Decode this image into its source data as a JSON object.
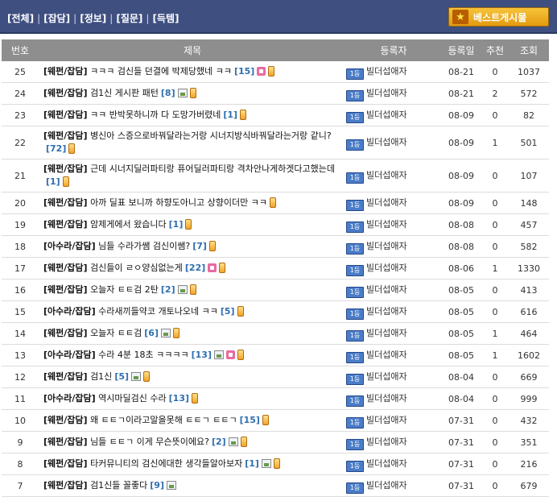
{
  "header": {
    "categories": [
      "[전체]",
      "[잡담]",
      "[정보]",
      "[질문]",
      "[득템]"
    ],
    "separator": "|",
    "best_button": "베스트게시물"
  },
  "table": {
    "columns": [
      "번호",
      "제목",
      "등록자",
      "등록일",
      "추천",
      "조회"
    ],
    "rows": [
      {
        "num": "25",
        "cat": "[웨펀/잡담]",
        "title": "ㅋㅋㅋ 검신들 던결에 박제당했네 ㅋㅋ",
        "comments": "[15]",
        "icons": [
          "movie",
          "mobile"
        ],
        "level": "1등",
        "author": "빌더섭애자",
        "date": "08-21",
        "rec": "0",
        "views": "1037"
      },
      {
        "num": "24",
        "cat": "[웨펀/잡담]",
        "title": "검1신 게시판 패턴",
        "comments": "[8]",
        "icons": [
          "image",
          "mobile"
        ],
        "level": "1등",
        "author": "빌더섭애자",
        "date": "08-21",
        "rec": "2",
        "views": "572"
      },
      {
        "num": "23",
        "cat": "[웨펀/잡담]",
        "title": "ㅋㅋ 반박못하니까 다 도망가버렸네",
        "comments": "[1]",
        "icons": [
          "mobile"
        ],
        "level": "1등",
        "author": "빌더섭애자",
        "date": "08-09",
        "rec": "0",
        "views": "82"
      },
      {
        "num": "22",
        "cat": "[웨펀/잡담]",
        "title": "병신아 스증으로바꿔달라는거랑 시너지방식바꿔달라는거랑 같니?",
        "comments": "[72]",
        "icons": [
          "mobile"
        ],
        "level": "1등",
        "author": "빌더섭애자",
        "date": "08-09",
        "rec": "1",
        "views": "501",
        "tall": true
      },
      {
        "num": "21",
        "cat": "[웨펀/잡담]",
        "title": "근데 시너지딜러파티랑 퓨어딜러파티랑 격차안나게하겟다고했는데",
        "comments": "[1]",
        "icons": [
          "mobile"
        ],
        "level": "1등",
        "author": "빌더섭애자",
        "date": "08-09",
        "rec": "0",
        "views": "107",
        "tall": true
      },
      {
        "num": "20",
        "cat": "[웨펀/잡담]",
        "title": "아까 딜표 보니까 하향도아니고 상향이더만 ㅋㅋ",
        "comments": "",
        "icons": [
          "mobile"
        ],
        "level": "1등",
        "author": "빌더섭애자",
        "date": "08-09",
        "rec": "0",
        "views": "148"
      },
      {
        "num": "19",
        "cat": "[웨펀/잡담]",
        "title": "암제게에서 왔습니다",
        "comments": "[1]",
        "icons": [
          "mobile"
        ],
        "level": "1등",
        "author": "빌더섭애자",
        "date": "08-08",
        "rec": "0",
        "views": "457"
      },
      {
        "num": "18",
        "cat": "[아수라/잡담]",
        "title": "님들 수라가쌤 검신이쌤?",
        "comments": "[7]",
        "icons": [
          "mobile"
        ],
        "level": "1등",
        "author": "빌더섭애자",
        "date": "08-08",
        "rec": "0",
        "views": "582"
      },
      {
        "num": "17",
        "cat": "[웨펀/잡담]",
        "title": "검신들이 ㄹㅇ양심없는게",
        "comments": "[22]",
        "icons": [
          "movie",
          "mobile"
        ],
        "level": "1등",
        "author": "빌더섭애자",
        "date": "08-06",
        "rec": "1",
        "views": "1330"
      },
      {
        "num": "16",
        "cat": "[웨펀/잡담]",
        "title": "오늘자 ㅌㅌ검 2탄",
        "comments": "[2]",
        "icons": [
          "image",
          "mobile"
        ],
        "level": "1등",
        "author": "빌더섭애자",
        "date": "08-05",
        "rec": "0",
        "views": "413"
      },
      {
        "num": "15",
        "cat": "[아수라/잡담]",
        "title": "수라새끼들약코 개토나오네 ㅋㅋ",
        "comments": "[5]",
        "icons": [
          "mobile"
        ],
        "level": "1등",
        "author": "빌더섭애자",
        "date": "08-05",
        "rec": "0",
        "views": "616"
      },
      {
        "num": "14",
        "cat": "[웨펀/잡담]",
        "title": "오늘자 ㅌㅌ검",
        "comments": "[6]",
        "icons": [
          "image",
          "mobile"
        ],
        "level": "1등",
        "author": "빌더섭애자",
        "date": "08-05",
        "rec": "1",
        "views": "464"
      },
      {
        "num": "13",
        "cat": "[아수라/잡담]",
        "title": "수라 4분 18초 ㅋㅋㅋㅋ",
        "comments": "[13]",
        "icons": [
          "image",
          "movie",
          "mobile"
        ],
        "level": "1등",
        "author": "빌더섭애자",
        "date": "08-05",
        "rec": "1",
        "views": "1602"
      },
      {
        "num": "12",
        "cat": "[웨펀/잡담]",
        "title": "검1신",
        "comments": "[5]",
        "icons": [
          "image",
          "mobile"
        ],
        "level": "1등",
        "author": "빌더섭애자",
        "date": "08-04",
        "rec": "0",
        "views": "669"
      },
      {
        "num": "11",
        "cat": "[아수라/잡담]",
        "title": "역시마딜검신 수라",
        "comments": "[13]",
        "icons": [
          "mobile"
        ],
        "level": "1등",
        "author": "빌더섭애자",
        "date": "08-04",
        "rec": "0",
        "views": "999"
      },
      {
        "num": "10",
        "cat": "[웨펀/잡담]",
        "title": "왜 ㅌㅌㄱ이라고말을못해 ㅌㅌㄱ ㅌㅌㄱ",
        "comments": "[15]",
        "icons": [
          "mobile"
        ],
        "level": "1등",
        "author": "빌더섭애자",
        "date": "07-31",
        "rec": "0",
        "views": "432"
      },
      {
        "num": "9",
        "cat": "[웨펀/잡담]",
        "title": "님들 ㅌㅌㄱ 이게 무슨뜻이에요?",
        "comments": "[2]",
        "icons": [
          "image",
          "mobile"
        ],
        "level": "1등",
        "author": "빌더섭애자",
        "date": "07-31",
        "rec": "0",
        "views": "351"
      },
      {
        "num": "8",
        "cat": "[웨펀/잡담]",
        "title": "타커뮤니티의 검신에대한 생각들알아보자",
        "comments": "[1]",
        "icons": [
          "image",
          "mobile"
        ],
        "level": "1등",
        "author": "빌더섭애자",
        "date": "07-31",
        "rec": "0",
        "views": "216"
      },
      {
        "num": "7",
        "cat": "[웨펀/잡담]",
        "title": "검1신들 꼴좋다",
        "comments": "[9]",
        "icons": [
          "image"
        ],
        "level": "1등",
        "author": "빌더섭애자",
        "date": "07-31",
        "rec": "0",
        "views": "679"
      }
    ]
  }
}
